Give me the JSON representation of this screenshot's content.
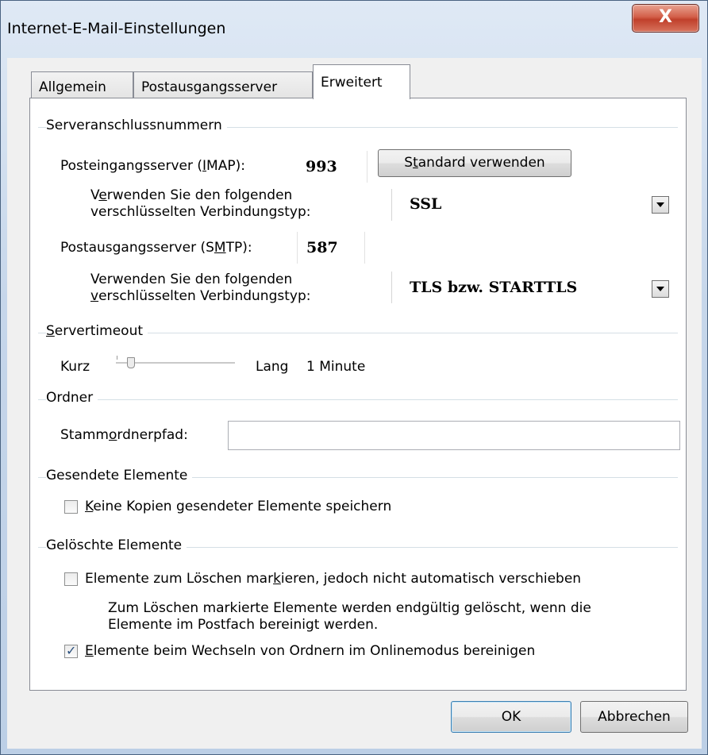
{
  "window": {
    "title": "Internet-E-Mail-Einstellungen",
    "close_glyph": "X"
  },
  "tabs": [
    {
      "label": "Allgemein",
      "active": false
    },
    {
      "label": "Postausgangsserver",
      "active": false
    },
    {
      "label": "Erweitert",
      "active": true
    }
  ],
  "ports": {
    "group": "Serveranschlussnummern",
    "imap": {
      "label_pre": "Posteingangsserver (",
      "label_key": "I",
      "label_post": "MAP):",
      "value": "993"
    },
    "default_button": {
      "pre": "S",
      "key": "t",
      "post": "andard verwenden"
    },
    "imap_enc": {
      "line1_pre": "V",
      "line1_key": "e",
      "line1_post": "rwenden Sie den folgenden",
      "line2": "verschlüsselten Verbindungstyp:",
      "value": "SSL"
    },
    "smtp": {
      "label_pre": "Postausgangsserver (S",
      "label_key": "M",
      "label_post": "TP):",
      "value": "587"
    },
    "smtp_enc": {
      "line1": "Verwenden Sie den folgenden",
      "line2_key": "v",
      "line2_post": "erschlüsselten Verbindungstyp:",
      "value": "TLS bzw. STARTTLS"
    }
  },
  "timeout": {
    "group_key": "S",
    "group_post": "ervertimeout",
    "min_label": "Kurz",
    "max_label": "Lang",
    "value_text": "1 Minute",
    "slider_level": 0.1
  },
  "folders": {
    "group": "Ordner",
    "root_label_pre": "Stamm",
    "root_label_key": "o",
    "root_label_post": "rdnerpfad:",
    "root_value": ""
  },
  "sent": {
    "group": "Gesendete Elemente",
    "option": {
      "key": "K",
      "post": "eine Kopien gesendeter Elemente speichern",
      "checked": false
    }
  },
  "deleted": {
    "group": "Gelöschte Elemente",
    "option1": {
      "pre": "Elemente zum Löschen mar",
      "key": "k",
      "post": "ieren, jedoch nicht automatisch verschieben",
      "checked": false
    },
    "note_line1": "Zum Löschen markierte Elemente werden endgültig gelöscht, wenn die",
    "note_line2": "Elemente im Postfach bereinigt werden.",
    "option2": {
      "key": "E",
      "post": "lemente beim Wechseln von Ordnern im Onlinemodus bereinigen",
      "checked": true
    }
  },
  "buttons": {
    "ok": "OK",
    "cancel": "Abbrechen"
  }
}
